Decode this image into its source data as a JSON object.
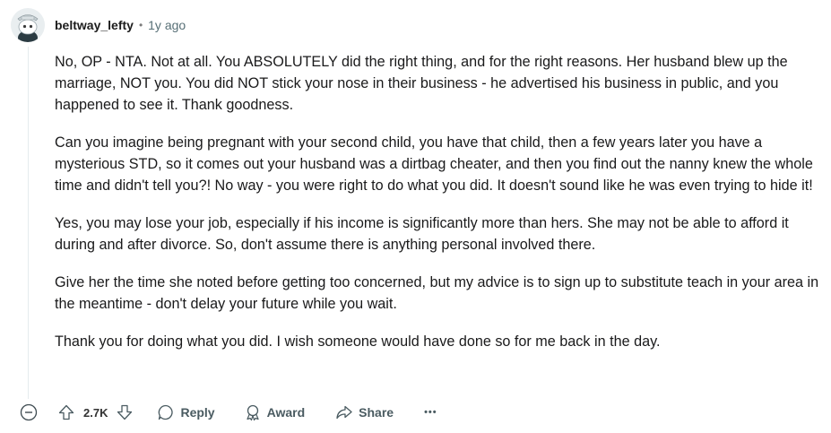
{
  "comment": {
    "username": "beltway_lefty",
    "separator": "•",
    "age": "1y ago",
    "paragraphs": [
      "No, OP - NTA. Not at all. You ABSOLUTELY did the right thing, and for the right reasons. Her husband blew up the marriage, NOT you. You did NOT stick your nose in their business - he advertised his business in public, and you happened to see it. Thank goodness.",
      "Can you imagine being pregnant with your second child, you have that child, then a few years later you have a mysterious STD, so it comes out your husband was a dirtbag cheater, and then you find out the nanny knew the whole time and didn't tell you?! No way - you were right to do what you did. It doesn't sound like he was even trying to hide it!",
      "Yes, you may lose your job, especially if his income is significantly more than hers. She may not be able to afford it during and after divorce. So, don't assume there is anything personal involved there.",
      "Give her the time she noted before getting too concerned, but my advice is to sign up to substitute teach in your area in the meantime - don't delay your future while you wait.",
      "Thank you for doing what you did. I wish someone would have done so for me back in the day."
    ]
  },
  "actions": {
    "score": "2.7K",
    "reply_label": "Reply",
    "award_label": "Award",
    "share_label": "Share",
    "more_label": "•••"
  },
  "icons": {
    "collapse": "minus-circle-icon",
    "upvote": "arrow-up-icon",
    "downvote": "arrow-down-icon",
    "reply": "speech-bubble-icon",
    "award": "award-ribbon-icon",
    "share": "share-arrow-icon",
    "more": "more-dots-icon"
  },
  "colors": {
    "text": "#1a1a1b",
    "meta": "#576f76",
    "thread_line": "#e5ebee"
  }
}
